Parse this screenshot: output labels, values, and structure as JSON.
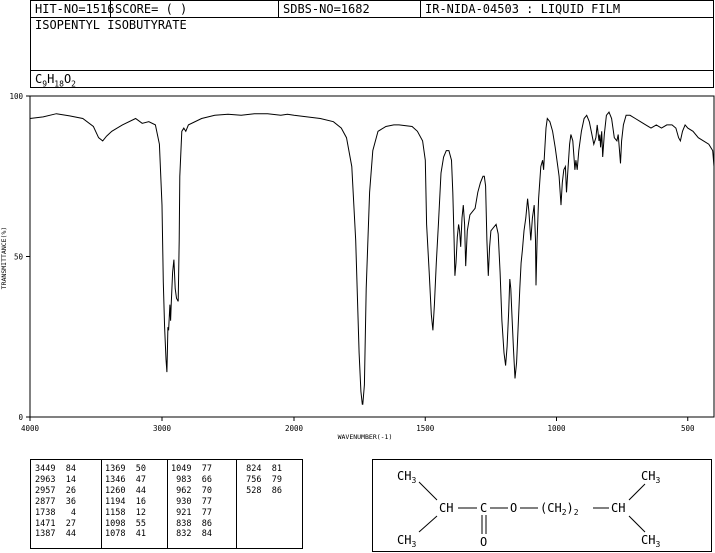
{
  "header": {
    "hit_no": "HIT-NO=1516",
    "score": "SCORE=  (  )",
    "sdbs_no": "SDBS-NO=1682",
    "ir_code": "IR-NIDA-04503 : LIQUID FILM"
  },
  "compound": {
    "name": "ISOPENTYL ISOBUTYRATE",
    "formula_base": [
      "C",
      "H",
      "O"
    ],
    "formula_sub": [
      "9",
      "18",
      "2"
    ]
  },
  "chart_data": {
    "type": "line",
    "title": "",
    "xlabel": "WAVENUMBER(-1)",
    "ylabel": "TRANSMITTANCE(%)",
    "xlim": [
      4000,
      400
    ],
    "ylim": [
      0,
      100
    ],
    "x_ticks": [
      4000,
      3000,
      2000,
      1500,
      1000,
      500
    ],
    "y_ticks": [
      0,
      50,
      100
    ],
    "x_tick_labels": [
      "4000",
      "3000",
      "2000",
      "1500",
      "1000",
      "500"
    ],
    "y_tick_labels": [
      "0",
      "50",
      "100"
    ],
    "grid": false,
    "spectrum": [
      [
        4000,
        93
      ],
      [
        3900,
        93.5
      ],
      [
        3800,
        94.5
      ],
      [
        3700,
        93.8
      ],
      [
        3600,
        93
      ],
      [
        3520,
        90.5
      ],
      [
        3480,
        87
      ],
      [
        3449,
        86
      ],
      [
        3420,
        87.5
      ],
      [
        3380,
        89
      ],
      [
        3300,
        91
      ],
      [
        3200,
        93
      ],
      [
        3150,
        91.5
      ],
      [
        3100,
        92
      ],
      [
        3050,
        91
      ],
      [
        3020,
        85
      ],
      [
        3000,
        66
      ],
      [
        2990,
        42
      ],
      [
        2980,
        28
      ],
      [
        2970,
        18
      ],
      [
        2963,
        14
      ],
      [
        2958,
        22
      ],
      [
        2955,
        28
      ],
      [
        2950,
        27
      ],
      [
        2940,
        35
      ],
      [
        2935,
        30
      ],
      [
        2930,
        35
      ],
      [
        2925,
        40
      ],
      [
        2920,
        45
      ],
      [
        2910,
        49
      ],
      [
        2900,
        40
      ],
      [
        2890,
        37
      ],
      [
        2877,
        36
      ],
      [
        2870,
        55
      ],
      [
        2865,
        75
      ],
      [
        2850,
        89
      ],
      [
        2835,
        90
      ],
      [
        2820,
        89
      ],
      [
        2800,
        91
      ],
      [
        2700,
        93
      ],
      [
        2600,
        94
      ],
      [
        2500,
        94.3
      ],
      [
        2400,
        94
      ],
      [
        2300,
        94.5
      ],
      [
        2200,
        94.5
      ],
      [
        2100,
        94
      ],
      [
        2050,
        94.3
      ],
      [
        2000,
        94
      ],
      [
        1950,
        93.5
      ],
      [
        1900,
        93
      ],
      [
        1850,
        92
      ],
      [
        1820,
        90
      ],
      [
        1800,
        87
      ],
      [
        1780,
        78
      ],
      [
        1765,
        55
      ],
      [
        1752,
        20
      ],
      [
        1745,
        8
      ],
      [
        1740,
        4
      ],
      [
        1738,
        4
      ],
      [
        1732,
        10
      ],
      [
        1725,
        40
      ],
      [
        1712,
        70
      ],
      [
        1700,
        83
      ],
      [
        1680,
        89
      ],
      [
        1650,
        90.5
      ],
      [
        1620,
        91
      ],
      [
        1600,
        91
      ],
      [
        1550,
        90.5
      ],
      [
        1530,
        89
      ],
      [
        1510,
        86
      ],
      [
        1500,
        80
      ],
      [
        1495,
        60
      ],
      [
        1485,
        45
      ],
      [
        1477,
        32
      ],
      [
        1471,
        27
      ],
      [
        1465,
        35
      ],
      [
        1458,
        48
      ],
      [
        1450,
        60
      ],
      [
        1440,
        76
      ],
      [
        1430,
        81
      ],
      [
        1420,
        83
      ],
      [
        1410,
        83
      ],
      [
        1400,
        80
      ],
      [
        1395,
        70
      ],
      [
        1390,
        55
      ],
      [
        1387,
        44
      ],
      [
        1383,
        48
      ],
      [
        1378,
        56
      ],
      [
        1373,
        60
      ],
      [
        1369,
        58
      ],
      [
        1365,
        53
      ],
      [
        1360,
        62
      ],
      [
        1355,
        66
      ],
      [
        1350,
        60
      ],
      [
        1346,
        47
      ],
      [
        1340,
        58
      ],
      [
        1330,
        63
      ],
      [
        1320,
        64
      ],
      [
        1310,
        65
      ],
      [
        1300,
        70
      ],
      [
        1290,
        73
      ],
      [
        1280,
        75
      ],
      [
        1275,
        75
      ],
      [
        1270,
        72
      ],
      [
        1265,
        55
      ],
      [
        1260,
        44
      ],
      [
        1255,
        53
      ],
      [
        1250,
        58
      ],
      [
        1240,
        59
      ],
      [
        1230,
        60
      ],
      [
        1222,
        57
      ],
      [
        1215,
        45
      ],
      [
        1208,
        30
      ],
      [
        1200,
        20
      ],
      [
        1194,
        16
      ],
      [
        1188,
        22
      ],
      [
        1182,
        33
      ],
      [
        1178,
        43
      ],
      [
        1174,
        40
      ],
      [
        1170,
        32
      ],
      [
        1164,
        21
      ],
      [
        1158,
        12
      ],
      [
        1152,
        17
      ],
      [
        1145,
        30
      ],
      [
        1140,
        40
      ],
      [
        1135,
        48
      ],
      [
        1130,
        52
      ],
      [
        1124,
        58
      ],
      [
        1117,
        62
      ],
      [
        1110,
        68
      ],
      [
        1105,
        64
      ],
      [
        1098,
        55
      ],
      [
        1092,
        62
      ],
      [
        1085,
        66
      ],
      [
        1080,
        55
      ],
      [
        1078,
        41
      ],
      [
        1074,
        55
      ],
      [
        1068,
        68
      ],
      [
        1060,
        78
      ],
      [
        1053,
        80
      ],
      [
        1049,
        77
      ],
      [
        1045,
        83
      ],
      [
        1040,
        90
      ],
      [
        1035,
        93
      ],
      [
        1025,
        92
      ],
      [
        1015,
        89
      ],
      [
        1005,
        84
      ],
      [
        995,
        78
      ],
      [
        990,
        75
      ],
      [
        983,
        66
      ],
      [
        978,
        73
      ],
      [
        972,
        77
      ],
      [
        966,
        78
      ],
      [
        962,
        70
      ],
      [
        958,
        75
      ],
      [
        950,
        85
      ],
      [
        945,
        88
      ],
      [
        938,
        86
      ],
      [
        930,
        77
      ],
      [
        926,
        80
      ],
      [
        921,
        77
      ],
      [
        915,
        83
      ],
      [
        905,
        89
      ],
      [
        895,
        93
      ],
      [
        885,
        94
      ],
      [
        875,
        92
      ],
      [
        865,
        88
      ],
      [
        858,
        85
      ],
      [
        850,
        87
      ],
      [
        845,
        91
      ],
      [
        838,
        86
      ],
      [
        835,
        88
      ],
      [
        832,
        84
      ],
      [
        828,
        89
      ],
      [
        824,
        81
      ],
      [
        818,
        88
      ],
      [
        810,
        94
      ],
      [
        800,
        95
      ],
      [
        790,
        93
      ],
      [
        780,
        87
      ],
      [
        770,
        86
      ],
      [
        765,
        88
      ],
      [
        760,
        83
      ],
      [
        756,
        79
      ],
      [
        752,
        86
      ],
      [
        745,
        91
      ],
      [
        735,
        94
      ],
      [
        720,
        94
      ],
      [
        700,
        93
      ],
      [
        680,
        92
      ],
      [
        660,
        91
      ],
      [
        640,
        90
      ],
      [
        620,
        91
      ],
      [
        600,
        90
      ],
      [
        580,
        91
      ],
      [
        560,
        91
      ],
      [
        545,
        90
      ],
      [
        535,
        87
      ],
      [
        528,
        86
      ],
      [
        520,
        89
      ],
      [
        510,
        91
      ],
      [
        500,
        90
      ],
      [
        480,
        89
      ],
      [
        460,
        87
      ],
      [
        440,
        86
      ],
      [
        420,
        85
      ],
      [
        405,
        83
      ],
      [
        400,
        78
      ]
    ]
  },
  "peak_table": {
    "columns": [
      [
        [
          "3449",
          "84"
        ],
        [
          "2963",
          "14"
        ],
        [
          "2957",
          "26"
        ],
        [
          "2877",
          "36"
        ],
        [
          "1738",
          "4"
        ],
        [
          "1471",
          "27"
        ],
        [
          "1387",
          "44"
        ]
      ],
      [
        [
          "1369",
          "50"
        ],
        [
          "1346",
          "47"
        ],
        [
          "1260",
          "44"
        ],
        [
          "1194",
          "16"
        ],
        [
          "1158",
          "12"
        ],
        [
          "1098",
          "55"
        ],
        [
          "1078",
          "41"
        ]
      ],
      [
        [
          "1049",
          "77"
        ],
        [
          "983",
          "66"
        ],
        [
          "962",
          "70"
        ],
        [
          "930",
          "77"
        ],
        [
          "921",
          "77"
        ],
        [
          "838",
          "86"
        ],
        [
          "832",
          "84"
        ]
      ],
      [
        [
          "824",
          "81"
        ],
        [
          "756",
          "79"
        ],
        [
          "528",
          "86"
        ]
      ]
    ]
  },
  "structure": {
    "ch3_top_left": "CH",
    "ch3_top_left_sub": "3",
    "ch3_bottom_left": "CH",
    "ch3_bottom_left_sub": "3",
    "ch3_top_right": "CH",
    "ch3_top_right_sub": "3",
    "ch3_bottom_right": "CH",
    "ch3_bottom_right_sub": "3",
    "ch_left": "CH",
    "c_carbonyl": "C",
    "o_ester": "O",
    "o_carbonyl": "O",
    "chain_open": "(CH",
    "chain_sub": "2",
    "chain_close": ")",
    "chain_n": "2",
    "ch_right": "CH"
  }
}
